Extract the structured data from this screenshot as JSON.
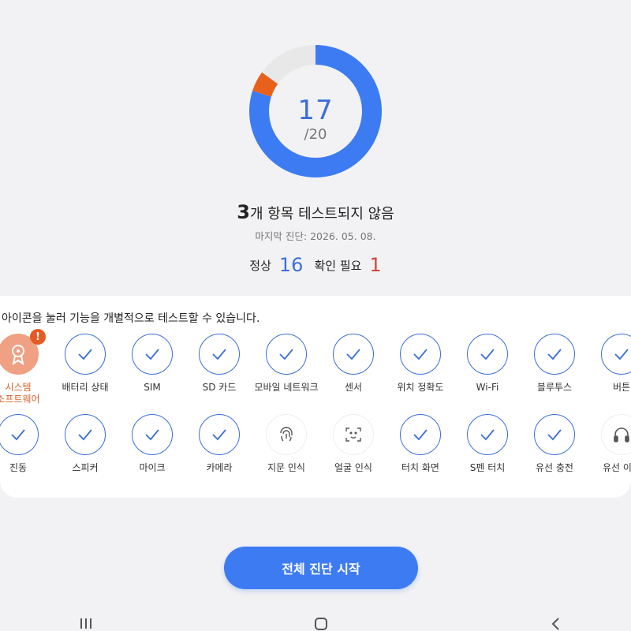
{
  "gauge": {
    "score": "17",
    "total": "/20",
    "normal_fraction": 0.8,
    "warning_fraction": 0.05,
    "untested_fraction": 0.15,
    "colors": {
      "normal": "#3d7bf2",
      "warning": "#e8611c",
      "untested": "#e8e8e8"
    }
  },
  "summary": {
    "count": "3",
    "text": "개 항목 테스트되지 않음",
    "last_diagnosis": "마지막 진단: 2026. 05. 08."
  },
  "counts": {
    "normal_label": "정상",
    "normal_value": "16",
    "check_label": "확인 필요",
    "check_value": "1"
  },
  "hint": "아이콘을 눌러 기능을 개별적으로 테스트할 수 있습니다.",
  "items_row1": [
    {
      "label": "시스템\n소프트웨어",
      "state": "alert",
      "icon": "award-ribbon-icon"
    },
    {
      "label": "배터리 상태",
      "state": "ok",
      "icon": "check-icon"
    },
    {
      "label": "SIM",
      "state": "ok",
      "icon": "check-icon"
    },
    {
      "label": "SD 카드",
      "state": "ok",
      "icon": "check-icon"
    },
    {
      "label": "모바일 네트워크",
      "state": "ok",
      "icon": "check-icon"
    },
    {
      "label": "센서",
      "state": "ok",
      "icon": "check-icon"
    },
    {
      "label": "위치 정확도",
      "state": "ok",
      "icon": "check-icon"
    },
    {
      "label": "Wi-Fi",
      "state": "ok",
      "icon": "check-icon"
    },
    {
      "label": "블루투스",
      "state": "ok",
      "icon": "check-icon"
    },
    {
      "label": "버튼",
      "state": "ok",
      "icon": "check-icon"
    }
  ],
  "items_row2": [
    {
      "label": "진동",
      "state": "ok",
      "icon": "check-icon"
    },
    {
      "label": "스피커",
      "state": "ok",
      "icon": "check-icon"
    },
    {
      "label": "마이크",
      "state": "ok",
      "icon": "check-icon"
    },
    {
      "label": "카메라",
      "state": "ok",
      "icon": "check-icon"
    },
    {
      "label": "지문 인식",
      "state": "untested",
      "icon": "fingerprint-icon"
    },
    {
      "label": "얼굴 인식",
      "state": "untested",
      "icon": "face-scan-icon"
    },
    {
      "label": "터치 화면",
      "state": "ok",
      "icon": "check-icon"
    },
    {
      "label": "S펜 터치",
      "state": "ok",
      "icon": "check-icon"
    },
    {
      "label": "유선 충전",
      "state": "ok",
      "icon": "check-icon"
    },
    {
      "label": "유선 이어",
      "state": "untested",
      "icon": "headphones-icon"
    }
  ],
  "alert_badge": "!",
  "cta_label": "전체 진단 시작",
  "nav": {
    "recent_icon": "recent-apps-icon",
    "home_icon": "home-icon",
    "back_icon": "back-icon"
  }
}
